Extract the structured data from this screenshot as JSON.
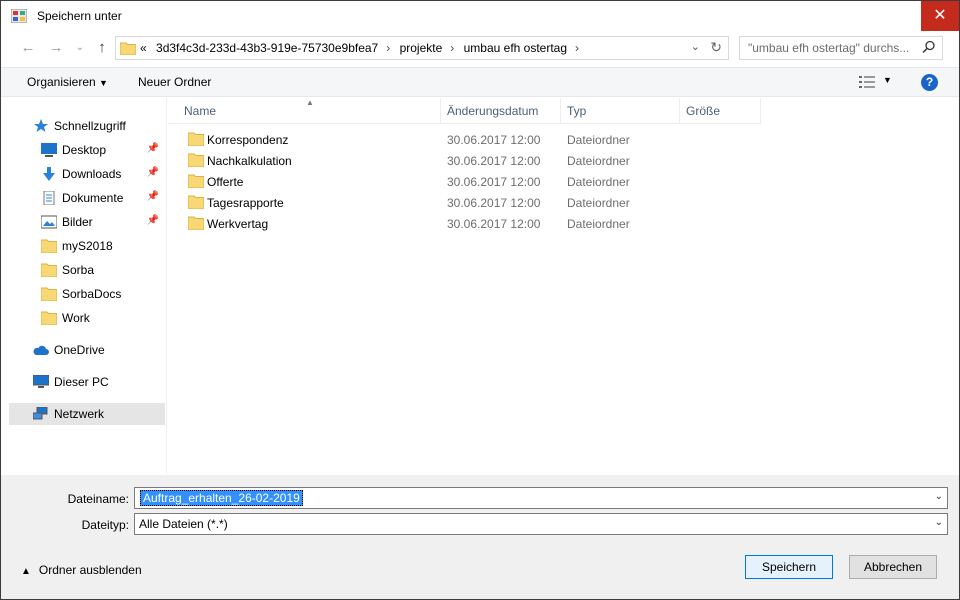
{
  "window": {
    "title": "Speichern unter",
    "close": "✕"
  },
  "address": {
    "crumbs": [
      "«",
      "3d3f4c3d-233d-43b3-919e-75730e9bfea7",
      "projekte",
      "umbau efh ostertag"
    ]
  },
  "search": {
    "placeholder": "\"umbau efh ostertag\" durchs..."
  },
  "toolbar": {
    "organize": "Organisieren",
    "new_folder": "Neuer Ordner"
  },
  "sidebar": {
    "items": [
      {
        "label": "Schnellzugriff",
        "icon": "star-icon"
      },
      {
        "label": "Desktop",
        "icon": "desktop-icon",
        "pinned": true
      },
      {
        "label": "Downloads",
        "icon": "download-icon",
        "pinned": true
      },
      {
        "label": "Dokumente",
        "icon": "document-icon",
        "pinned": true
      },
      {
        "label": "Bilder",
        "icon": "pictures-icon",
        "pinned": true
      },
      {
        "label": "myS2018",
        "icon": "folder-icon"
      },
      {
        "label": "Sorba",
        "icon": "folder-icon"
      },
      {
        "label": "SorbaDocs",
        "icon": "folder-icon"
      },
      {
        "label": "Work",
        "icon": "folder-icon"
      },
      {
        "label": "OneDrive",
        "icon": "cloud-icon"
      },
      {
        "label": "Dieser PC",
        "icon": "pc-icon"
      },
      {
        "label": "Netzwerk",
        "icon": "network-icon",
        "selected": true
      }
    ]
  },
  "columns": {
    "name": "Name",
    "date": "Änderungsdatum",
    "type": "Typ",
    "size": "Größe"
  },
  "files": [
    {
      "name": "Korrespondenz",
      "date": "30.06.2017 12:00",
      "type": "Dateiordner"
    },
    {
      "name": "Nachkalkulation",
      "date": "30.06.2017 12:00",
      "type": "Dateiordner"
    },
    {
      "name": "Offerte",
      "date": "30.06.2017 12:00",
      "type": "Dateiordner"
    },
    {
      "name": "Tagesrapporte",
      "date": "30.06.2017 12:00",
      "type": "Dateiordner"
    },
    {
      "name": "Werkvertag",
      "date": "30.06.2017 12:00",
      "type": "Dateiordner"
    }
  ],
  "form": {
    "filename_label": "Dateiname:",
    "filename_value": "Auftrag_erhalten_26-02-2019",
    "filetype_label": "Dateityp:",
    "filetype_value": "Alle Dateien (*.*)"
  },
  "footer": {
    "hide_folders": "Ordner ausblenden",
    "save": "Speichern",
    "cancel": "Abbrechen"
  },
  "colors": {
    "accent": "#0078d7",
    "close": "#c42b1c",
    "folder": "#f8d775",
    "header_text": "#4c607a"
  }
}
